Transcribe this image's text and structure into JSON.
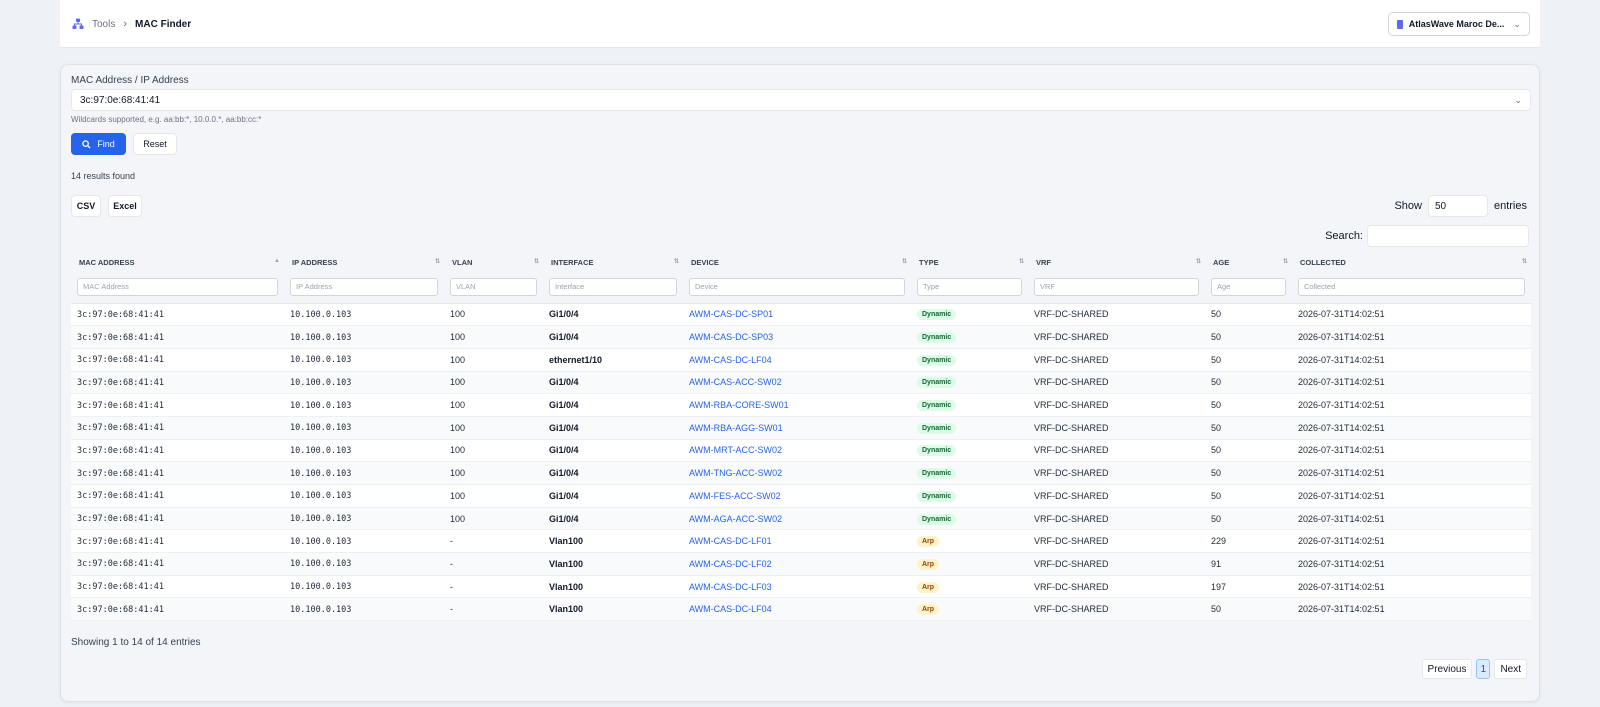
{
  "breadcrumb": {
    "parent": "Tools",
    "separator": "›",
    "current": "MAC Finder"
  },
  "tenant": {
    "label": "AtlasWave Maroc De..."
  },
  "search": {
    "label": "MAC Address / IP Address",
    "value": "3c:97:0e:68:41:41",
    "hint": "Wildcards supported, e.g. aa:bb:*, 10.0.0.*, aa:bb:cc:*"
  },
  "buttons": {
    "find": "Find",
    "reset": "Reset",
    "csv": "CSV",
    "excel": "Excel"
  },
  "results_text": "14 results found",
  "length": {
    "prefix": "Show",
    "value": "50",
    "suffix": "entries"
  },
  "table_search_label": "Search:",
  "columns": [
    {
      "label": "MAC ADDRESS",
      "filter": "MAC Address"
    },
    {
      "label": "IP ADDRESS",
      "filter": "IP Address"
    },
    {
      "label": "VLAN",
      "filter": "VLAN"
    },
    {
      "label": "INTERFACE",
      "filter": "Interface"
    },
    {
      "label": "DEVICE",
      "filter": "Device"
    },
    {
      "label": "TYPE",
      "filter": "Type"
    },
    {
      "label": "VRF",
      "filter": "VRF"
    },
    {
      "label": "AGE",
      "filter": "Age"
    },
    {
      "label": "COLLECTED",
      "filter": "Collected"
    }
  ],
  "rows": [
    {
      "mac": "3c:97:0e:68:41:41",
      "ip": "10.100.0.103",
      "vlan": "100",
      "iface": "Gi1/0/4",
      "device": "AWM-CAS-DC-SP01",
      "type": "Dynamic",
      "vrf": "VRF-DC-SHARED",
      "age": "50",
      "collected": "2026-07-31T14:02:51"
    },
    {
      "mac": "3c:97:0e:68:41:41",
      "ip": "10.100.0.103",
      "vlan": "100",
      "iface": "Gi1/0/4",
      "device": "AWM-CAS-DC-SP03",
      "type": "Dynamic",
      "vrf": "VRF-DC-SHARED",
      "age": "50",
      "collected": "2026-07-31T14:02:51"
    },
    {
      "mac": "3c:97:0e:68:41:41",
      "ip": "10.100.0.103",
      "vlan": "100",
      "iface": "ethernet1/10",
      "device": "AWM-CAS-DC-LF04",
      "type": "Dynamic",
      "vrf": "VRF-DC-SHARED",
      "age": "50",
      "collected": "2026-07-31T14:02:51"
    },
    {
      "mac": "3c:97:0e:68:41:41",
      "ip": "10.100.0.103",
      "vlan": "100",
      "iface": "Gi1/0/4",
      "device": "AWM-CAS-ACC-SW02",
      "type": "Dynamic",
      "vrf": "VRF-DC-SHARED",
      "age": "50",
      "collected": "2026-07-31T14:02:51"
    },
    {
      "mac": "3c:97:0e:68:41:41",
      "ip": "10.100.0.103",
      "vlan": "100",
      "iface": "Gi1/0/4",
      "device": "AWM-RBA-CORE-SW01",
      "type": "Dynamic",
      "vrf": "VRF-DC-SHARED",
      "age": "50",
      "collected": "2026-07-31T14:02:51"
    },
    {
      "mac": "3c:97:0e:68:41:41",
      "ip": "10.100.0.103",
      "vlan": "100",
      "iface": "Gi1/0/4",
      "device": "AWM-RBA-AGG-SW01",
      "type": "Dynamic",
      "vrf": "VRF-DC-SHARED",
      "age": "50",
      "collected": "2026-07-31T14:02:51"
    },
    {
      "mac": "3c:97:0e:68:41:41",
      "ip": "10.100.0.103",
      "vlan": "100",
      "iface": "Gi1/0/4",
      "device": "AWM-MRT-ACC-SW02",
      "type": "Dynamic",
      "vrf": "VRF-DC-SHARED",
      "age": "50",
      "collected": "2026-07-31T14:02:51"
    },
    {
      "mac": "3c:97:0e:68:41:41",
      "ip": "10.100.0.103",
      "vlan": "100",
      "iface": "Gi1/0/4",
      "device": "AWM-TNG-ACC-SW02",
      "type": "Dynamic",
      "vrf": "VRF-DC-SHARED",
      "age": "50",
      "collected": "2026-07-31T14:02:51"
    },
    {
      "mac": "3c:97:0e:68:41:41",
      "ip": "10.100.0.103",
      "vlan": "100",
      "iface": "Gi1/0/4",
      "device": "AWM-FES-ACC-SW02",
      "type": "Dynamic",
      "vrf": "VRF-DC-SHARED",
      "age": "50",
      "collected": "2026-07-31T14:02:51"
    },
    {
      "mac": "3c:97:0e:68:41:41",
      "ip": "10.100.0.103",
      "vlan": "100",
      "iface": "Gi1/0/4",
      "device": "AWM-AGA-ACC-SW02",
      "type": "Dynamic",
      "vrf": "VRF-DC-SHARED",
      "age": "50",
      "collected": "2026-07-31T14:02:51"
    },
    {
      "mac": "3c:97:0e:68:41:41",
      "ip": "10.100.0.103",
      "vlan": "-",
      "iface": "Vlan100",
      "device": "AWM-CAS-DC-LF01",
      "type": "Arp",
      "vrf": "VRF-DC-SHARED",
      "age": "229",
      "collected": "2026-07-31T14:02:51"
    },
    {
      "mac": "3c:97:0e:68:41:41",
      "ip": "10.100.0.103",
      "vlan": "-",
      "iface": "Vlan100",
      "device": "AWM-CAS-DC-LF02",
      "type": "Arp",
      "vrf": "VRF-DC-SHARED",
      "age": "91",
      "collected": "2026-07-31T14:02:51"
    },
    {
      "mac": "3c:97:0e:68:41:41",
      "ip": "10.100.0.103",
      "vlan": "-",
      "iface": "Vlan100",
      "device": "AWM-CAS-DC-LF03",
      "type": "Arp",
      "vrf": "VRF-DC-SHARED",
      "age": "197",
      "collected": "2026-07-31T14:02:51"
    },
    {
      "mac": "3c:97:0e:68:41:41",
      "ip": "10.100.0.103",
      "vlan": "-",
      "iface": "Vlan100",
      "device": "AWM-CAS-DC-LF04",
      "type": "Arp",
      "vrf": "VRF-DC-SHARED",
      "age": "50",
      "collected": "2026-07-31T14:02:51"
    }
  ],
  "info_text": "Showing 1 to 14 of 14 entries",
  "pagination": {
    "previous": "Previous",
    "current": "1",
    "next": "Next"
  },
  "colors": {
    "accent": "#2563eb",
    "dynamic_badge": "#dcfce7",
    "arp_badge": "#fef3c7"
  }
}
